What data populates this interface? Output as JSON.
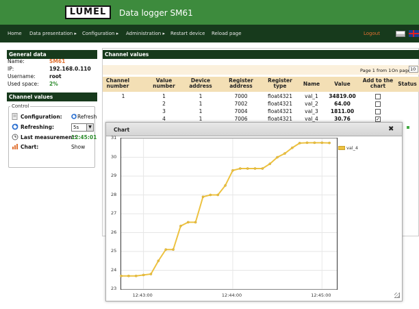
{
  "header": {
    "logo": "LUMEL",
    "title": "Data logger SM61"
  },
  "nav": {
    "items": [
      "Home",
      "Data presentation ▸",
      "Configuration ▸",
      "Administration ▸",
      "Restart device",
      "Reload page"
    ],
    "logout": "Logout"
  },
  "general": {
    "title": "General data",
    "name_label": "Name:",
    "name_value": "SM61",
    "ip_label": "IP:",
    "ip_value": "192.168.0.110",
    "user_label": "Username:",
    "user_value": "root",
    "space_label": "Used space:",
    "space_value": "2%"
  },
  "channel_sidebar": {
    "title": "Channel values",
    "control_legend": "Control",
    "config_label": "Configuration:",
    "refresh_link": "Refresh",
    "refreshing_label": "Refreshing:",
    "refreshing_value": "5s",
    "last_label": "Last measurement:",
    "last_value": "12:45:01",
    "chart_label": "Chart:",
    "chart_value": "Show"
  },
  "channel_panel": {
    "title": "Channel values",
    "pager_text": "Page 1 from 1",
    "per_page_label": "On page",
    "per_page_value": "10",
    "headers": [
      "Channel number",
      "Value number",
      "Device address",
      "Register address",
      "Register type",
      "Name",
      "Value",
      "Add to the chart",
      "Status"
    ],
    "rows": [
      {
        "channel": "1",
        "value_number": "1",
        "device": "1",
        "register": "7000",
        "type": "float4321",
        "name": "val_1",
        "value": "34819.00",
        "checked": false
      },
      {
        "channel": "",
        "value_number": "2",
        "device": "1",
        "register": "7002",
        "type": "float4321",
        "name": "val_2",
        "value": "64.00",
        "checked": false
      },
      {
        "channel": "",
        "value_number": "3",
        "device": "1",
        "register": "7004",
        "type": "float4321",
        "name": "val_3",
        "value": "1811.00",
        "checked": false
      },
      {
        "channel": "",
        "value_number": "4",
        "device": "1",
        "register": "7006",
        "type": "float4321",
        "name": "val_4",
        "value": "30.76",
        "checked": true
      }
    ]
  },
  "chart_dialog": {
    "title": "Chart",
    "close": "✖"
  },
  "chart_data": {
    "type": "line",
    "series": [
      {
        "name": "val_4",
        "color": "#edc240",
        "x": [
          "12:42:45",
          "12:42:50",
          "12:42:55",
          "12:43:00",
          "12:43:05",
          "12:43:10",
          "12:43:15",
          "12:43:20",
          "12:43:25",
          "12:43:30",
          "12:43:35",
          "12:43:40",
          "12:43:45",
          "12:43:50",
          "12:43:55",
          "12:44:00",
          "12:44:05",
          "12:44:10",
          "12:44:15",
          "12:44:20",
          "12:44:25",
          "12:44:30",
          "12:44:35",
          "12:44:40",
          "12:44:45",
          "12:44:50",
          "12:44:55",
          "12:45:00",
          "12:45:05"
        ],
        "values": [
          23.7,
          23.7,
          23.7,
          23.75,
          23.8,
          24.5,
          25.1,
          25.1,
          26.35,
          26.55,
          26.55,
          27.9,
          28.0,
          28.0,
          28.5,
          29.3,
          29.4,
          29.4,
          29.4,
          29.4,
          29.65,
          30.0,
          30.2,
          30.5,
          30.75,
          30.77,
          30.77,
          30.77,
          30.76
        ]
      }
    ],
    "x_ticks": [
      "12:43:00",
      "12:44:00",
      "12:45:00"
    ],
    "y_ticks": [
      "23",
      "24",
      "25",
      "26",
      "27",
      "28",
      "29",
      "30",
      "31"
    ],
    "ylim": [
      23,
      31
    ],
    "xlim": [
      "12:42:45",
      "12:45:10"
    ],
    "legend": "top-right outside plot",
    "grid": true
  }
}
